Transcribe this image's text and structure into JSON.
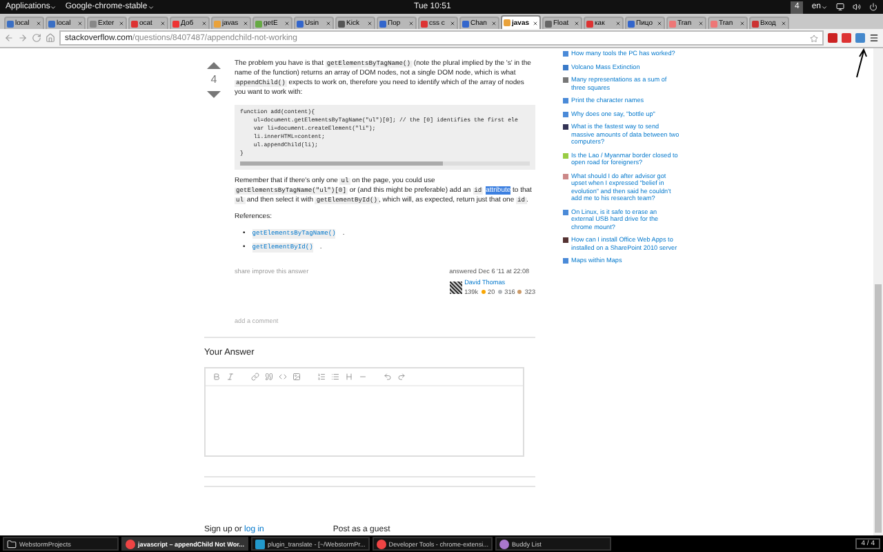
{
  "top_panel": {
    "applications": "Applications",
    "app_menu": "Google-chrome-stable",
    "clock": "Tue 10:51",
    "workspace": "4",
    "language": "en"
  },
  "tabs": [
    {
      "label": "local",
      "selected": false
    },
    {
      "label": "local",
      "selected": false
    },
    {
      "label": "Exter",
      "selected": false
    },
    {
      "label": "ocat",
      "selected": false
    },
    {
      "label": "Доб",
      "selected": false
    },
    {
      "label": "javas",
      "selected": false
    },
    {
      "label": "getE",
      "selected": false
    },
    {
      "label": "Usin",
      "selected": false
    },
    {
      "label": "Kick",
      "selected": false
    },
    {
      "label": "Пор",
      "selected": false
    },
    {
      "label": "css c",
      "selected": false
    },
    {
      "label": "Chan",
      "selected": false
    },
    {
      "label": "javas",
      "selected": true
    },
    {
      "label": "Float",
      "selected": false
    },
    {
      "label": "как",
      "selected": false
    },
    {
      "label": "Пицо",
      "selected": false
    },
    {
      "label": "Tran",
      "selected": false
    },
    {
      "label": "Tran",
      "selected": false
    },
    {
      "label": "Вход",
      "selected": false
    }
  ],
  "address_bar": {
    "domain": "stackoverflow.com",
    "path": "/questions/8407487/appendchild-not-working"
  },
  "answer": {
    "votes": "4",
    "paragraph_1": [
      {
        "kind": "text",
        "text": "The problem you have is that "
      },
      {
        "kind": "code",
        "text": "getElementsByTagName()"
      },
      {
        "kind": "text",
        "text": " (note the plural implied by the 's' in the name of the function) returns an array of DOM nodes, not a single DOM node, which is what "
      },
      {
        "kind": "code",
        "text": "appendChild()"
      },
      {
        "kind": "text",
        "text": " expects to work on, therefore you need to identify which of the array of nodes you want to work with:"
      }
    ],
    "code_lines": [
      "function add(content){",
      "    ul=document.getElementsByTagName(\"ul\")[0]; // the [0] identifies the first ele",
      "    var li=document.createElement(\"li\");",
      "    li.innerHTML=content;",
      "    ul.appendChild(li);",
      "}"
    ],
    "paragraph_2": [
      {
        "kind": "text",
        "text": "Remember that if there's only one "
      },
      {
        "kind": "code",
        "text": "ul"
      },
      {
        "kind": "text",
        "text": " on the page, you could use "
      },
      {
        "kind": "code",
        "text": "getElementsByTagName(\"ul\")[0]"
      },
      {
        "kind": "text",
        "text": " or (and this might be preferable) add an "
      },
      {
        "kind": "code",
        "text": "id"
      },
      {
        "kind": "highlight",
        "text": "attribute"
      },
      {
        "kind": "text",
        "text": " to that "
      },
      {
        "kind": "code",
        "text": "ul"
      },
      {
        "kind": "text",
        "text": " and then select it with "
      },
      {
        "kind": "code",
        "text": "getElementById()"
      },
      {
        "kind": "text",
        "text": ", which will, as expected, return just that one "
      },
      {
        "kind": "code",
        "text": "id"
      },
      {
        "kind": "text",
        "text": "."
      }
    ],
    "references_heading": "References:",
    "references": [
      {
        "marker": "•",
        "link": "getElementsByTagName()",
        "after": "."
      },
      {
        "marker": "•",
        "link": "getElementById()",
        "after": "."
      }
    ],
    "actions": "share improve this answer",
    "answered": "answered Dec 6 '11 at 22:08",
    "author": "David Thomas",
    "reputation": "139k",
    "badges": [
      {
        "count": "20",
        "color": "#f9a602"
      },
      {
        "count": "316",
        "color": "#b4b8bc"
      },
      {
        "count": "323",
        "color": "#cc9966"
      }
    ],
    "add_comment": "add a comment"
  },
  "your_answer": {
    "heading": "Your Answer",
    "sign_up": "Sign up or ",
    "log_in": "log in",
    "guest": "Post as a guest"
  },
  "sidebar": {
    "items": [
      "How many tools the PC has worked?",
      "Volcano Mass Extinction",
      "Many representations as a sum of three squares",
      "Print the character names",
      "Why does one say, \"bottle up\"",
      "What is the fastest way to send massive amounts of data between two computers?",
      "Is the Lao / Myanmar border closed to open road for foreigners?",
      "What should I do after advisor got upset when I expressed \"belief in evolution\" and then said he couldn't add me to his research team?",
      "On Linux, is it safe to erase an external USB hard drive for the chrome mount?",
      "How can I install Office Web Apps to installed on a SharePoint 2010 server",
      "Maps within Maps"
    ]
  },
  "taskbar": {
    "items": [
      {
        "label": "WebstormProjects",
        "kind": "folder",
        "selected": false
      },
      {
        "label": "javascript – appendChild Not Wor...",
        "kind": "chrome",
        "selected": true
      },
      {
        "label": "plugin_translate - [~/WebstormPr...",
        "kind": "webstorm",
        "selected": false
      },
      {
        "label": "Developer Tools - chrome-extensi...",
        "kind": "chrome",
        "selected": false
      },
      {
        "label": "Buddy List",
        "kind": "pidgin",
        "selected": false
      }
    ],
    "pager": "4 / 4"
  }
}
